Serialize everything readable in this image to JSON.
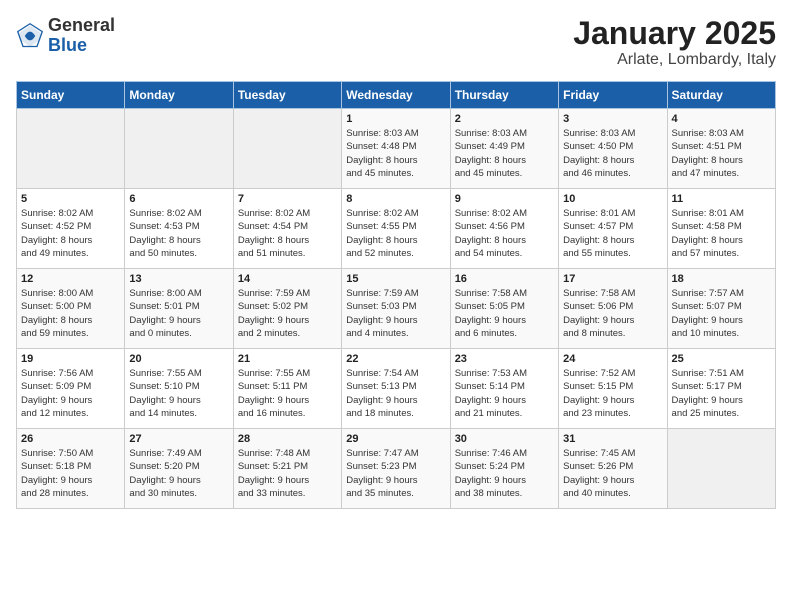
{
  "logo": {
    "general": "General",
    "blue": "Blue"
  },
  "calendar": {
    "title": "January 2025",
    "subtitle": "Arlate, Lombardy, Italy"
  },
  "weekdays": [
    "Sunday",
    "Monday",
    "Tuesday",
    "Wednesday",
    "Thursday",
    "Friday",
    "Saturday"
  ],
  "weeks": [
    [
      {
        "day": "",
        "info": ""
      },
      {
        "day": "",
        "info": ""
      },
      {
        "day": "",
        "info": ""
      },
      {
        "day": "1",
        "info": "Sunrise: 8:03 AM\nSunset: 4:48 PM\nDaylight: 8 hours\nand 45 minutes."
      },
      {
        "day": "2",
        "info": "Sunrise: 8:03 AM\nSunset: 4:49 PM\nDaylight: 8 hours\nand 45 minutes."
      },
      {
        "day": "3",
        "info": "Sunrise: 8:03 AM\nSunset: 4:50 PM\nDaylight: 8 hours\nand 46 minutes."
      },
      {
        "day": "4",
        "info": "Sunrise: 8:03 AM\nSunset: 4:51 PM\nDaylight: 8 hours\nand 47 minutes."
      }
    ],
    [
      {
        "day": "5",
        "info": "Sunrise: 8:02 AM\nSunset: 4:52 PM\nDaylight: 8 hours\nand 49 minutes."
      },
      {
        "day": "6",
        "info": "Sunrise: 8:02 AM\nSunset: 4:53 PM\nDaylight: 8 hours\nand 50 minutes."
      },
      {
        "day": "7",
        "info": "Sunrise: 8:02 AM\nSunset: 4:54 PM\nDaylight: 8 hours\nand 51 minutes."
      },
      {
        "day": "8",
        "info": "Sunrise: 8:02 AM\nSunset: 4:55 PM\nDaylight: 8 hours\nand 52 minutes."
      },
      {
        "day": "9",
        "info": "Sunrise: 8:02 AM\nSunset: 4:56 PM\nDaylight: 8 hours\nand 54 minutes."
      },
      {
        "day": "10",
        "info": "Sunrise: 8:01 AM\nSunset: 4:57 PM\nDaylight: 8 hours\nand 55 minutes."
      },
      {
        "day": "11",
        "info": "Sunrise: 8:01 AM\nSunset: 4:58 PM\nDaylight: 8 hours\nand 57 minutes."
      }
    ],
    [
      {
        "day": "12",
        "info": "Sunrise: 8:00 AM\nSunset: 5:00 PM\nDaylight: 8 hours\nand 59 minutes."
      },
      {
        "day": "13",
        "info": "Sunrise: 8:00 AM\nSunset: 5:01 PM\nDaylight: 9 hours\nand 0 minutes."
      },
      {
        "day": "14",
        "info": "Sunrise: 7:59 AM\nSunset: 5:02 PM\nDaylight: 9 hours\nand 2 minutes."
      },
      {
        "day": "15",
        "info": "Sunrise: 7:59 AM\nSunset: 5:03 PM\nDaylight: 9 hours\nand 4 minutes."
      },
      {
        "day": "16",
        "info": "Sunrise: 7:58 AM\nSunset: 5:05 PM\nDaylight: 9 hours\nand 6 minutes."
      },
      {
        "day": "17",
        "info": "Sunrise: 7:58 AM\nSunset: 5:06 PM\nDaylight: 9 hours\nand 8 minutes."
      },
      {
        "day": "18",
        "info": "Sunrise: 7:57 AM\nSunset: 5:07 PM\nDaylight: 9 hours\nand 10 minutes."
      }
    ],
    [
      {
        "day": "19",
        "info": "Sunrise: 7:56 AM\nSunset: 5:09 PM\nDaylight: 9 hours\nand 12 minutes."
      },
      {
        "day": "20",
        "info": "Sunrise: 7:55 AM\nSunset: 5:10 PM\nDaylight: 9 hours\nand 14 minutes."
      },
      {
        "day": "21",
        "info": "Sunrise: 7:55 AM\nSunset: 5:11 PM\nDaylight: 9 hours\nand 16 minutes."
      },
      {
        "day": "22",
        "info": "Sunrise: 7:54 AM\nSunset: 5:13 PM\nDaylight: 9 hours\nand 18 minutes."
      },
      {
        "day": "23",
        "info": "Sunrise: 7:53 AM\nSunset: 5:14 PM\nDaylight: 9 hours\nand 21 minutes."
      },
      {
        "day": "24",
        "info": "Sunrise: 7:52 AM\nSunset: 5:15 PM\nDaylight: 9 hours\nand 23 minutes."
      },
      {
        "day": "25",
        "info": "Sunrise: 7:51 AM\nSunset: 5:17 PM\nDaylight: 9 hours\nand 25 minutes."
      }
    ],
    [
      {
        "day": "26",
        "info": "Sunrise: 7:50 AM\nSunset: 5:18 PM\nDaylight: 9 hours\nand 28 minutes."
      },
      {
        "day": "27",
        "info": "Sunrise: 7:49 AM\nSunset: 5:20 PM\nDaylight: 9 hours\nand 30 minutes."
      },
      {
        "day": "28",
        "info": "Sunrise: 7:48 AM\nSunset: 5:21 PM\nDaylight: 9 hours\nand 33 minutes."
      },
      {
        "day": "29",
        "info": "Sunrise: 7:47 AM\nSunset: 5:23 PM\nDaylight: 9 hours\nand 35 minutes."
      },
      {
        "day": "30",
        "info": "Sunrise: 7:46 AM\nSunset: 5:24 PM\nDaylight: 9 hours\nand 38 minutes."
      },
      {
        "day": "31",
        "info": "Sunrise: 7:45 AM\nSunset: 5:26 PM\nDaylight: 9 hours\nand 40 minutes."
      },
      {
        "day": "",
        "info": ""
      }
    ]
  ]
}
